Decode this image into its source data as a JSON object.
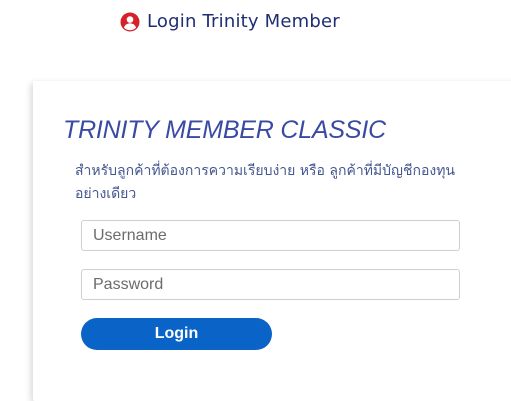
{
  "header": {
    "login_link_label": "Login Trinity Member",
    "icon": "user-circle-icon",
    "icon_color": "#d6202a",
    "link_color": "#1f2e73"
  },
  "panel": {
    "title": "TRINITY MEMBER CLASSIC",
    "description": "สำหรับลูกค้าที่ต้องการความเรียบง่าย หรือ ลูกค้าที่มีบัญชีกองทุนอย่างเดียว",
    "title_color": "#3a4aa3"
  },
  "form": {
    "username_placeholder": "Username",
    "username_value": "",
    "password_placeholder": "Password",
    "password_value": "",
    "login_button_label": "Login",
    "button_color": "#0a64c8"
  }
}
